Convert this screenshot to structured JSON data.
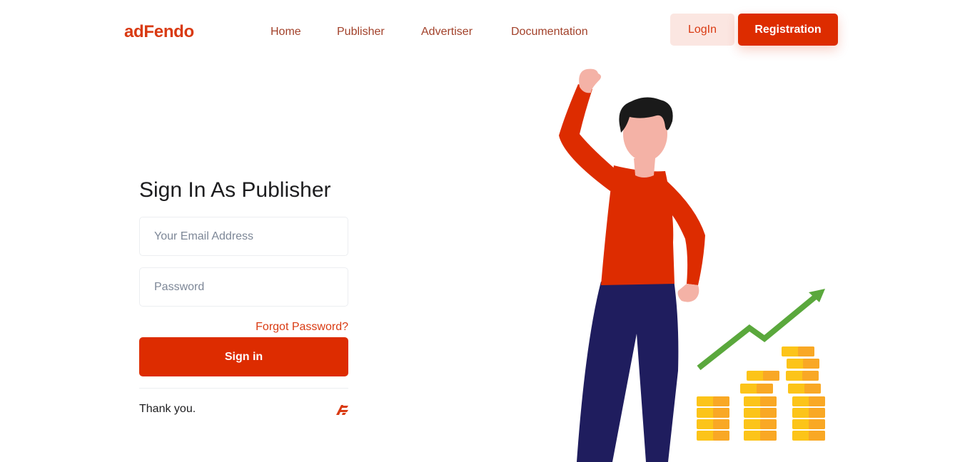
{
  "brand": {
    "name": "adFendo"
  },
  "nav": {
    "items": [
      "Home",
      "Publisher",
      "Advertiser",
      "Documentation"
    ],
    "login_label": "LogIn",
    "register_label": "Registration"
  },
  "form": {
    "title": "Sign In As Publisher",
    "email_placeholder": "Your Email Address",
    "password_placeholder": "Password",
    "forgot_label": "Forgot Password?",
    "signin_label": "Sign in",
    "footer_text": "Thank you."
  },
  "colors": {
    "accent": "#dd2c00",
    "accent_light": "#fbe6e1",
    "nav_text": "#a2412a",
    "shirt": "#dd2c00",
    "pants": "#1f1d5e",
    "arrow": "#5aa83c",
    "coin": "#fcc419"
  },
  "icons": {
    "mini_logo": "adfendo-mark-icon",
    "illustration": "man-waving-with-growth-chart-illustration"
  }
}
